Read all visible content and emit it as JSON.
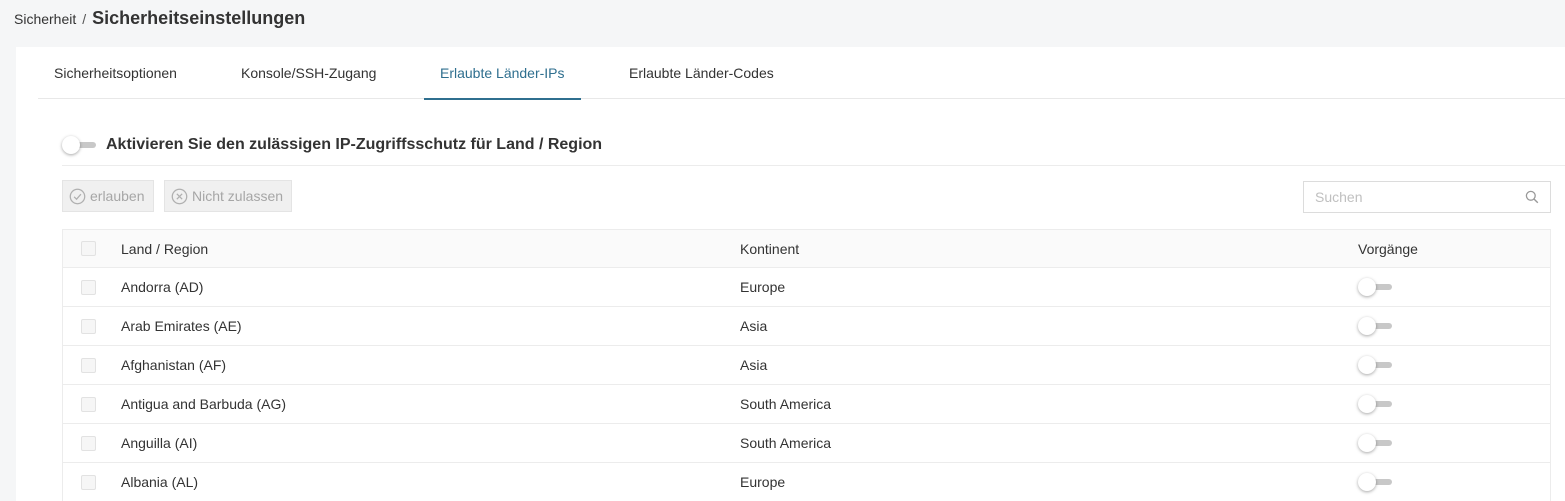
{
  "breadcrumb": {
    "parent": "Sicherheit",
    "separator": "/",
    "current": "Sicherheitseinstellungen"
  },
  "tabs": [
    {
      "label": "Sicherheitsoptionen",
      "active": false
    },
    {
      "label": "Konsole/SSH-Zugang",
      "active": false
    },
    {
      "label": "Erlaubte Länder-IPs",
      "active": true
    },
    {
      "label": "Erlaubte Länder-Codes",
      "active": false
    }
  ],
  "protection": {
    "label": "Aktivieren Sie den zulässigen IP-Zugriffsschutz für Land / Region",
    "enabled": false
  },
  "toolbar": {
    "allow_label": "erlauben",
    "deny_label": "Nicht zulassen"
  },
  "search": {
    "placeholder": "Suchen",
    "value": ""
  },
  "table": {
    "columns": {
      "name": "Land / Region",
      "continent": "Kontinent",
      "operations": "Vorgänge"
    },
    "rows": [
      {
        "name": "Andorra (AD)",
        "continent": "Europe",
        "enabled": false
      },
      {
        "name": "Arab Emirates (AE)",
        "continent": "Asia",
        "enabled": false
      },
      {
        "name": "Afghanistan (AF)",
        "continent": "Asia",
        "enabled": false
      },
      {
        "name": "Antigua and Barbuda (AG)",
        "continent": "South America",
        "enabled": false
      },
      {
        "name": "Anguilla (AI)",
        "continent": "South America",
        "enabled": false
      },
      {
        "name": "Albania (AL)",
        "continent": "Europe",
        "enabled": false
      }
    ]
  },
  "colors": {
    "accent": "#2f6f8f",
    "disabled_text": "#a6a6a6",
    "border": "#ececec"
  }
}
